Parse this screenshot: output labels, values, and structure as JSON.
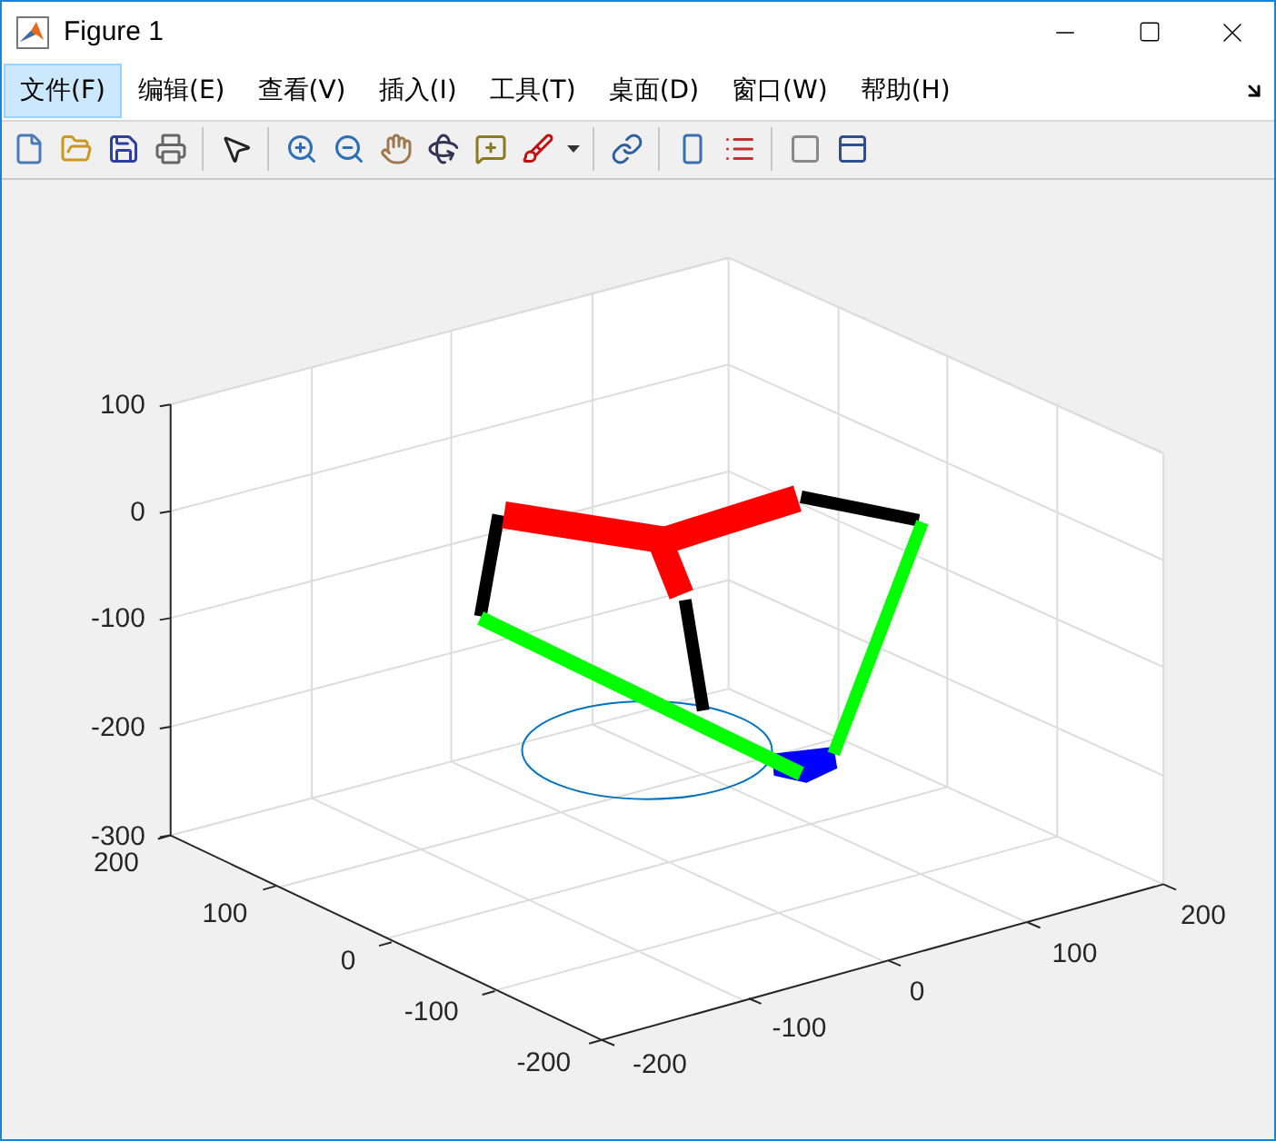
{
  "window": {
    "title": "Figure 1"
  },
  "menu": [
    {
      "label": "文件(F)",
      "selected": true
    },
    {
      "label": "编辑(E)",
      "selected": false
    },
    {
      "label": "查看(V)",
      "selected": false
    },
    {
      "label": "插入(I)",
      "selected": false
    },
    {
      "label": "工具(T)",
      "selected": false
    },
    {
      "label": "桌面(D)",
      "selected": false
    },
    {
      "label": "窗口(W)",
      "selected": false
    },
    {
      "label": "帮助(H)",
      "selected": false
    }
  ],
  "axes": {
    "z_ticks": [
      "100",
      "0",
      "-100",
      "-200",
      "-300"
    ],
    "y_ticks": [
      "200",
      "100",
      "0",
      "-100",
      "-200"
    ],
    "x_ticks": [
      "-200",
      "-100",
      "0",
      "100",
      "200"
    ]
  }
}
